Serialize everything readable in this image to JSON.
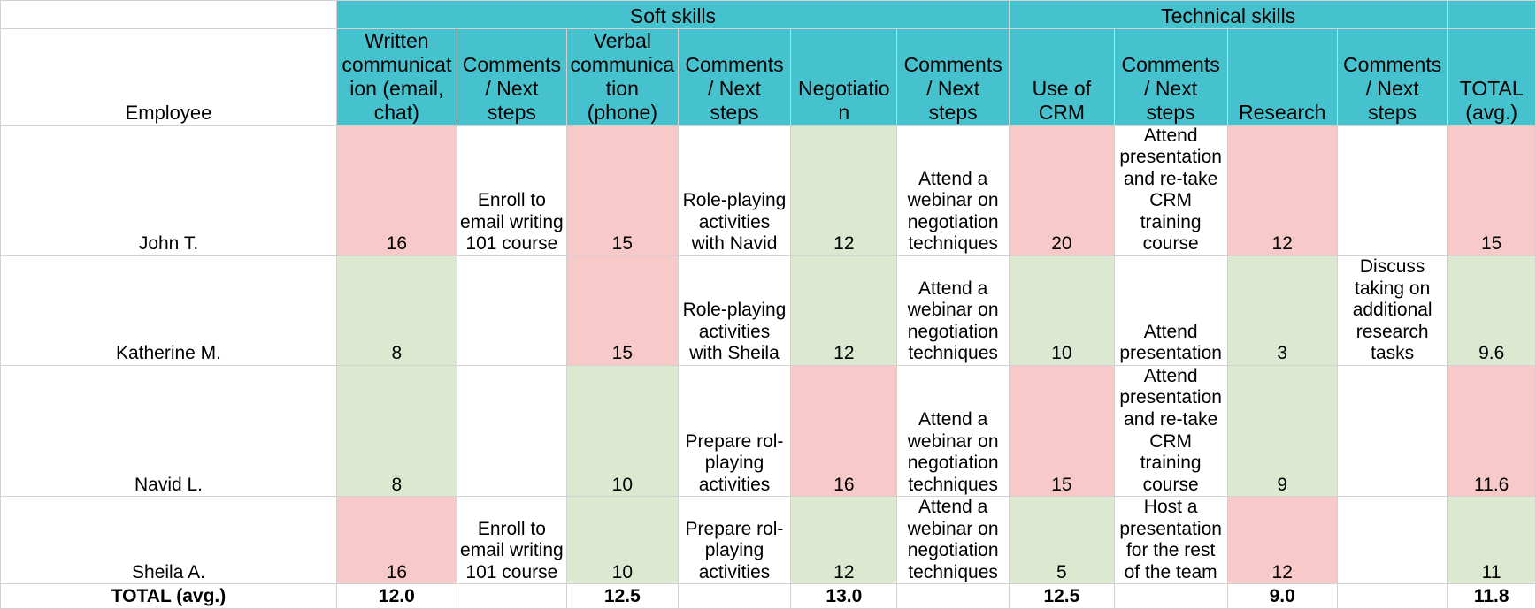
{
  "colors": {
    "header_teal": "#45c2cd",
    "low_score_red": "#f7cac9",
    "high_score_green": "#dce9d0",
    "white": "#ffffff",
    "gridline": "#d2d2d2"
  },
  "group_headers": [
    {
      "label": "",
      "span": 1
    },
    {
      "label": "Soft skills",
      "span": 6
    },
    {
      "label": "Technical skills",
      "span": 4
    },
    {
      "label": "",
      "span": 1
    }
  ],
  "columns": [
    {
      "key": "employee",
      "label": "Employee"
    },
    {
      "key": "written",
      "label": "Written communication (email, chat)"
    },
    {
      "key": "written_c",
      "label": "Comments / Next steps"
    },
    {
      "key": "verbal",
      "label": "Verbal communication (phone)"
    },
    {
      "key": "verbal_c",
      "label": "Comments / Next steps"
    },
    {
      "key": "negotiation",
      "label": "Negotiation"
    },
    {
      "key": "negotiation_c",
      "label": "Comments / Next steps"
    },
    {
      "key": "crm",
      "label": "Use of CRM"
    },
    {
      "key": "crm_c",
      "label": "Comments / Next steps"
    },
    {
      "key": "research",
      "label": "Research"
    },
    {
      "key": "research_c",
      "label": "Comments / Next steps"
    },
    {
      "key": "total",
      "label": "TOTAL (avg.)"
    }
  ],
  "rows": [
    {
      "employee": "John T.",
      "written": {
        "value": "16",
        "fill": "red"
      },
      "written_c": {
        "value": "Enroll to email writing 101 course",
        "fill": "white"
      },
      "verbal": {
        "value": "15",
        "fill": "red"
      },
      "verbal_c": {
        "value": "Role-playing activities with Navid",
        "fill": "white"
      },
      "negotiation": {
        "value": "12",
        "fill": "green"
      },
      "negotiation_c": {
        "value": "Attend a webinar on negotiation techniques",
        "fill": "white"
      },
      "crm": {
        "value": "20",
        "fill": "red"
      },
      "crm_c": {
        "value": "Attend presentation and re-take CRM training course",
        "fill": "white"
      },
      "research": {
        "value": "12",
        "fill": "red"
      },
      "research_c": {
        "value": "",
        "fill": "white"
      },
      "total": {
        "value": "15",
        "fill": "red"
      }
    },
    {
      "employee": "Katherine M.",
      "written": {
        "value": "8",
        "fill": "green"
      },
      "written_c": {
        "value": "",
        "fill": "white"
      },
      "verbal": {
        "value": "15",
        "fill": "red"
      },
      "verbal_c": {
        "value": "Role-playing activities with Sheila",
        "fill": "white"
      },
      "negotiation": {
        "value": "12",
        "fill": "green"
      },
      "negotiation_c": {
        "value": "Attend a webinar on negotiation techniques",
        "fill": "white"
      },
      "crm": {
        "value": "10",
        "fill": "green"
      },
      "crm_c": {
        "value": "Attend presentation",
        "fill": "white"
      },
      "research": {
        "value": "3",
        "fill": "green"
      },
      "research_c": {
        "value": "Discuss taking on additional research tasks",
        "fill": "white"
      },
      "total": {
        "value": "9.6",
        "fill": "green"
      }
    },
    {
      "employee": "Navid L.",
      "written": {
        "value": "8",
        "fill": "green"
      },
      "written_c": {
        "value": "",
        "fill": "white"
      },
      "verbal": {
        "value": "10",
        "fill": "green"
      },
      "verbal_c": {
        "value": "Prepare rol-playing activities",
        "fill": "white"
      },
      "negotiation": {
        "value": "16",
        "fill": "red"
      },
      "negotiation_c": {
        "value": "Attend a webinar on negotiation techniques",
        "fill": "white"
      },
      "crm": {
        "value": "15",
        "fill": "red"
      },
      "crm_c": {
        "value": "Attend presentation and re-take CRM training course",
        "fill": "white"
      },
      "research": {
        "value": "9",
        "fill": "green"
      },
      "research_c": {
        "value": "",
        "fill": "white"
      },
      "total": {
        "value": "11.6",
        "fill": "red"
      }
    },
    {
      "employee": "Sheila A.",
      "written": {
        "value": "16",
        "fill": "red"
      },
      "written_c": {
        "value": "Enroll to email writing 101 course",
        "fill": "white"
      },
      "verbal": {
        "value": "10",
        "fill": "green"
      },
      "verbal_c": {
        "value": "Prepare rol-playing activities",
        "fill": "white"
      },
      "negotiation": {
        "value": "12",
        "fill": "green"
      },
      "negotiation_c": {
        "value": "Attend a webinar on negotiation techniques",
        "fill": "white"
      },
      "crm": {
        "value": "5",
        "fill": "green"
      },
      "crm_c": {
        "value": "Host a presentation for the rest of the team",
        "fill": "white"
      },
      "research": {
        "value": "12",
        "fill": "red"
      },
      "research_c": {
        "value": "",
        "fill": "white"
      },
      "total": {
        "value": "11",
        "fill": "green"
      }
    }
  ],
  "totals_row": {
    "label": "TOTAL (avg.)",
    "written": "12.0",
    "written_c": "",
    "verbal": "12.5",
    "verbal_c": "",
    "negotiation": "13.0",
    "negotiation_c": "",
    "crm": "12.5",
    "crm_c": "",
    "research": "9.0",
    "research_c": "",
    "total": "11.8"
  },
  "chart_data": {
    "type": "table",
    "title": "Employee skills scorecard",
    "group_headers": [
      "Soft skills",
      "Technical skills"
    ],
    "categories": [
      "John T.",
      "Katherine M.",
      "Navid L.",
      "Sheila A."
    ],
    "series": [
      {
        "name": "Written communication (email, chat)",
        "values": [
          16,
          8,
          8,
          16
        ],
        "average": 12.0
      },
      {
        "name": "Verbal communication (phone)",
        "values": [
          15,
          15,
          10,
          10
        ],
        "average": 12.5
      },
      {
        "name": "Negotiation",
        "values": [
          12,
          12,
          16,
          12
        ],
        "average": 13.0
      },
      {
        "name": "Use of CRM",
        "values": [
          20,
          10,
          15,
          5
        ],
        "average": 12.5
      },
      {
        "name": "Research",
        "values": [
          12,
          3,
          9,
          12
        ],
        "average": 9.0
      },
      {
        "name": "TOTAL (avg.)",
        "values": [
          15,
          9.6,
          11.6,
          11
        ],
        "average": 11.8
      }
    ]
  }
}
